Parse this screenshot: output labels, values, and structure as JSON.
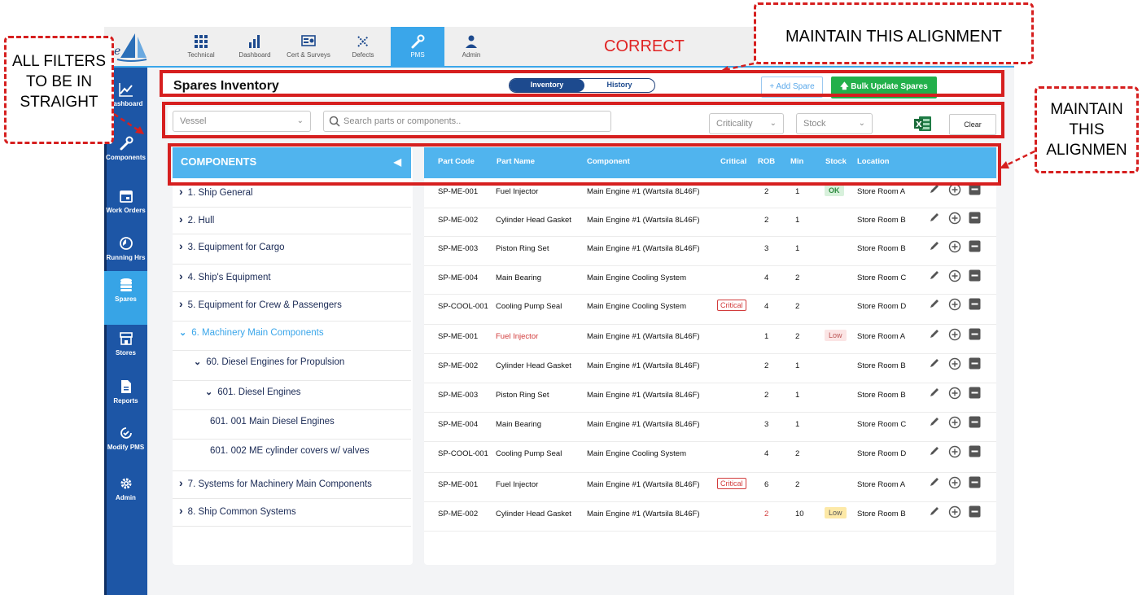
{
  "annotations": {
    "left_note": "ALL FILTERS TO BE IN STRAIGHT",
    "correct": "CORRECT",
    "top_note": "MAINTAIN THIS ALIGNMENT",
    "right_note": "MAINTAIN THIS ALIGNMEN"
  },
  "topnav": {
    "items": [
      {
        "label": "Technical",
        "icon": "grid-icon"
      },
      {
        "label": "Dashboard",
        "icon": "bar-chart-icon"
      },
      {
        "label": "Cert & Surveys",
        "icon": "certificate-icon"
      },
      {
        "label": "Defects",
        "icon": "tools-icon"
      },
      {
        "label": "PMS",
        "icon": "wrench-icon",
        "active": true
      },
      {
        "label": "Admin",
        "icon": "user-icon"
      }
    ]
  },
  "sidebar": {
    "items": [
      {
        "label": "Dashboard",
        "icon": "line-chart-icon"
      },
      {
        "label": "Components",
        "icon": "wrench-icon"
      },
      {
        "label": "Work Orders",
        "icon": "calendar-icon"
      },
      {
        "label": "Running Hrs",
        "icon": "clock-icon"
      },
      {
        "label": "Spares",
        "icon": "database-icon",
        "active": true
      },
      {
        "label": "Stores",
        "icon": "store-icon"
      },
      {
        "label": "Reports",
        "icon": "document-icon"
      },
      {
        "label": "Modify PMS",
        "icon": "refresh-icon"
      },
      {
        "label": "Admin",
        "icon": "gear-icon"
      }
    ]
  },
  "header": {
    "title": "Spares Inventory",
    "toggle": {
      "active": "Inventory",
      "inactive": "History"
    },
    "add_spare": "+ Add Spare",
    "bulk_update": "Bulk Update Spares"
  },
  "filters": {
    "vessel": "Vessel",
    "search_placeholder": "Search parts or components..",
    "criticality": "Criticality",
    "stock": "Stock",
    "clear": "Clear"
  },
  "components": {
    "header": "COMPONENTS",
    "tree": [
      {
        "label": "1. Ship General",
        "marker": "›"
      },
      {
        "label": "2. Hull",
        "marker": "›"
      },
      {
        "label": "3. Equipment for Cargo",
        "marker": "›"
      },
      {
        "label": "4. Ship's Equipment",
        "marker": "›"
      },
      {
        "label": "5. Equipment for Crew & Passengers",
        "marker": "›"
      },
      {
        "label": "6. Machinery Main Components",
        "marker": "⌄",
        "active": true
      },
      {
        "label": "60. Diesel Engines for Propulsion",
        "marker": "⌄"
      },
      {
        "label": "601. Diesel Engines",
        "marker": "⌄"
      },
      {
        "label": "601. 001 Main Diesel Engines",
        "marker": ""
      },
      {
        "label": "601. 002 ME cylinder covers w/ valves",
        "marker": ""
      },
      {
        "label": "7. Systems for Machinery Main Components",
        "marker": "›"
      },
      {
        "label": "8. Ship Common Systems",
        "marker": "›"
      }
    ]
  },
  "table": {
    "columns": [
      "Part Code",
      "Part Name",
      "Component",
      "Critical",
      "ROB",
      "Min",
      "Stock",
      "Location"
    ],
    "rows": [
      {
        "code": "SP-ME-001",
        "name": "Fuel Injector",
        "component": "Main Engine #1 (Wartsila 8L46F)",
        "critical": "",
        "rob": "2",
        "min": "1",
        "stock": "OK",
        "location": "Store Room A"
      },
      {
        "code": "SP-ME-002",
        "name": "Cylinder Head Gasket",
        "component": "Main Engine #1 (Wartsila 8L46F)",
        "critical": "",
        "rob": "2",
        "min": "1",
        "stock": "",
        "location": "Store Room B"
      },
      {
        "code": "SP-ME-003",
        "name": "Piston Ring Set",
        "component": "Main Engine #1 (Wartsila 8L46F)",
        "critical": "",
        "rob": "3",
        "min": "1",
        "stock": "",
        "location": "Store Room B"
      },
      {
        "code": "SP-ME-004",
        "name": "Main Bearing",
        "component": "Main Engine Cooling System",
        "critical": "",
        "rob": "4",
        "min": "2",
        "stock": "",
        "location": "Store Room C"
      },
      {
        "code": "SP-COOL-001",
        "name": "Cooling Pump Seal",
        "component": "Main Engine Cooling System",
        "critical": "Critical",
        "rob": "4",
        "min": "2",
        "stock": "",
        "location": "Store Room D"
      },
      {
        "code": "SP-ME-001",
        "name": "Fuel Injector",
        "component": "Main Engine #1 (Wartsila 8L46F)",
        "critical": "",
        "rob": "1",
        "min": "2",
        "stock": "Low",
        "location": "Store Room A"
      },
      {
        "code": "SP-ME-002",
        "name": "Cylinder Head Gasket",
        "component": "Main Engine #1 (Wartsila 8L46F)",
        "critical": "",
        "rob": "2",
        "min": "1",
        "stock": "",
        "location": "Store Room B"
      },
      {
        "code": "SP-ME-003",
        "name": "Piston Ring Set",
        "component": "Main Engine #1 (Wartsila 8L46F)",
        "critical": "",
        "rob": "2",
        "min": "1",
        "stock": "",
        "location": "Store Room B"
      },
      {
        "code": "SP-ME-004",
        "name": "Main Bearing",
        "component": "Main Engine #1 (Wartsila 8L46F)",
        "critical": "",
        "rob": "3",
        "min": "1",
        "stock": "",
        "location": "Store Room C"
      },
      {
        "code": "SP-COOL-001",
        "name": "Cooling Pump Seal",
        "component": "Main Engine Cooling System",
        "critical": "",
        "rob": "4",
        "min": "2",
        "stock": "",
        "location": "Store Room D"
      },
      {
        "code": "SP-ME-001",
        "name": "Fuel Injector",
        "component": "Main Engine #1 (Wartsila 8L46F)",
        "critical": "Critical",
        "rob": "6",
        "min": "2",
        "stock": "",
        "location": "Store Room A"
      },
      {
        "code": "SP-ME-002",
        "name": "Cylinder Head Gasket",
        "component": "Main Engine #1 (Wartsila 8L46F)",
        "critical": "",
        "rob": "2",
        "min": "10",
        "stock": "Low",
        "location": "Store Room B"
      }
    ]
  },
  "colors": {
    "sidebar": "#1d56a6",
    "accent": "#50b4ee",
    "green": "#22b04b",
    "annotation": "#d61f1f"
  }
}
